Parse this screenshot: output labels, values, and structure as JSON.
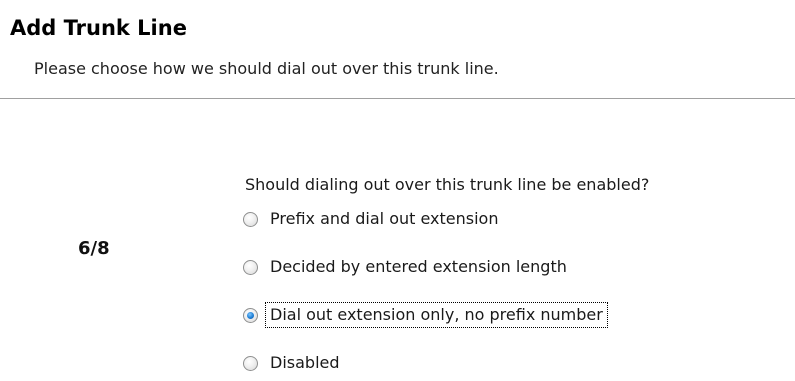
{
  "header": {
    "title": "Add Trunk Line",
    "subtitle": "Please choose how we should dial out over this trunk line."
  },
  "wizard": {
    "step": "6/8"
  },
  "dialout": {
    "question": "Should dialing out over this trunk line be enabled?",
    "options": [
      {
        "label": "Prefix and dial out extension",
        "checked": false
      },
      {
        "label": "Decided by entered extension length",
        "checked": false
      },
      {
        "label": "Dial out extension only, no prefix number",
        "checked": true,
        "focused": true
      },
      {
        "label": "Disabled",
        "checked": false
      }
    ],
    "selected_index": 2
  },
  "colors": {
    "radio_dot": "#1f7fd6",
    "divider": "#a0a0a0",
    "background": "#ffffff"
  }
}
